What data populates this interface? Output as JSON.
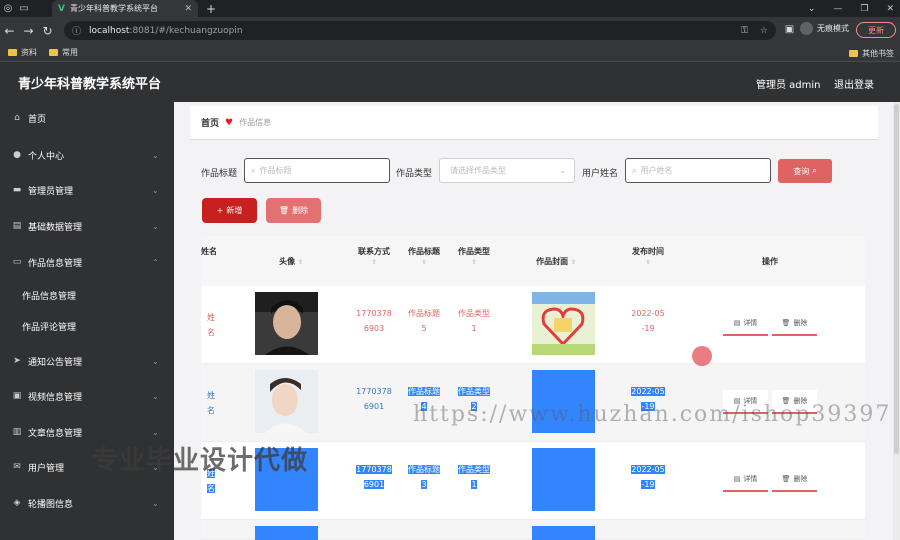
{
  "browser": {
    "tab_title": "青少年科普教学系统平台",
    "url_host": "localhost",
    "url_path": ":8081/#/kechuangzuopin",
    "incognito_label": "无痕模式",
    "update_label": "更新",
    "bookmarks": [
      "资料",
      "常用"
    ],
    "other_bookmarks": "其他书签"
  },
  "app": {
    "title": "青少年科普教学系统平台",
    "user_label": "管理员 admin",
    "logout_label": "退出登录"
  },
  "sidebar": {
    "items": [
      {
        "label": "首页",
        "icon": "home-icon"
      },
      {
        "label": "个人中心",
        "icon": "user-icon"
      },
      {
        "label": "管理员管理",
        "icon": "admin-icon"
      },
      {
        "label": "基础数据管理",
        "icon": "database-icon"
      },
      {
        "label": "作品信息管理",
        "icon": "works-icon"
      },
      {
        "label": "通知公告管理",
        "icon": "megaphone-icon"
      },
      {
        "label": "视频信息管理",
        "icon": "video-icon"
      },
      {
        "label": "文章信息管理",
        "icon": "article-icon"
      },
      {
        "label": "用户管理",
        "icon": "mail-icon"
      },
      {
        "label": "轮播图信息",
        "icon": "carousel-icon"
      }
    ],
    "subitems": [
      "作品信息管理",
      "作品评论管理"
    ]
  },
  "breadcrumb": {
    "home": "首页",
    "current": "作品信息"
  },
  "search": {
    "title_label": "作品标题",
    "title_placeholder": "作品标题",
    "type_label": "作品类型",
    "type_placeholder": "请选择作品类型",
    "user_label": "用户姓名",
    "user_placeholder": "用户姓名",
    "query_label": "查询"
  },
  "actions": {
    "add_label": "新增",
    "delete_label": "删除"
  },
  "table": {
    "headers": {
      "name": "姓名",
      "avatar": "头像",
      "contact": "联系方式",
      "title": "作品标题",
      "type": "作品类型",
      "cover": "作品封面",
      "time": "发布时间",
      "ops": "操作"
    },
    "rows": [
      {
        "name": "姓名",
        "contact1": "1770378",
        "contact2": "6903",
        "title1": "作品标题",
        "title2": "5",
        "type1": "作品类型",
        "type2": "1",
        "time1": "2022-05",
        "time2": "-19"
      },
      {
        "name": "姓名",
        "contact1": "1770378",
        "contact2": "6901",
        "title1": "作品标题",
        "title2": "4",
        "type1": "作品类型",
        "type2": "2",
        "time1": "2022-05",
        "time2": "-19"
      },
      {
        "name": "姓名",
        "contact1": "1770378",
        "contact2": "6901",
        "title1": "作品标题",
        "title2": "3",
        "type1": "作品类型",
        "type2": "1",
        "time1": "2022-05",
        "time2": "-19"
      }
    ],
    "detail_label": "详情",
    "row_delete_label": "删除"
  },
  "watermark": {
    "url_text": "https://www.huzhan.com/ishop39397",
    "ad_text": "专业毕业设计代做"
  }
}
